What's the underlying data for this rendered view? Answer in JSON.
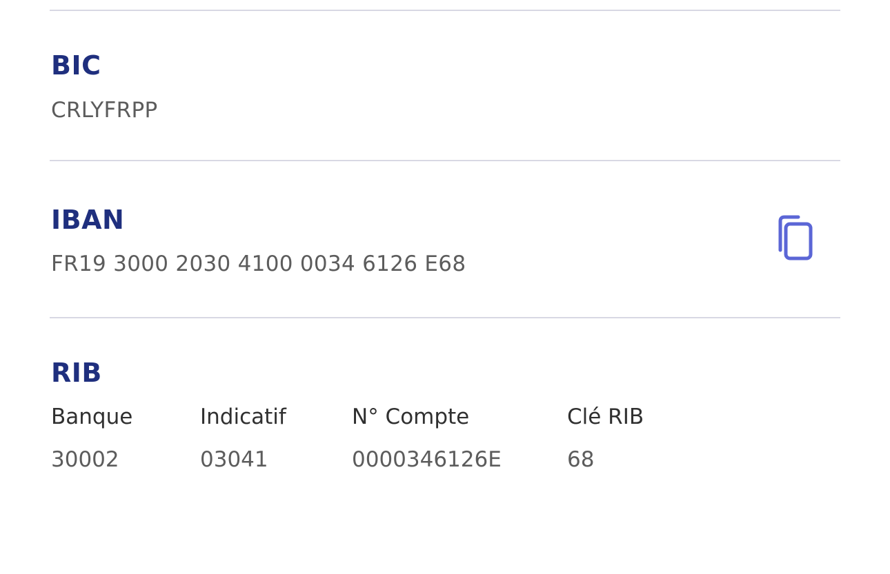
{
  "bic": {
    "label": "BIC",
    "value": "CRLYFRPP"
  },
  "iban": {
    "label": "IBAN",
    "value": "FR19 3000 2030 4100 0034 6126 E68",
    "copy_icon": "copy-icon"
  },
  "rib": {
    "label": "RIB",
    "columns": [
      {
        "header": "Banque",
        "value": "30002"
      },
      {
        "header": "Indicatif",
        "value": "03041"
      },
      {
        "header": "N° Compte",
        "value": "0000346126E"
      },
      {
        "header": "Clé RIB",
        "value": "68"
      }
    ]
  },
  "colors": {
    "title": "#1f2f7e",
    "value": "#5c5c5c",
    "accent_icon": "#5b66d6",
    "divider": "#d8d8e4"
  }
}
